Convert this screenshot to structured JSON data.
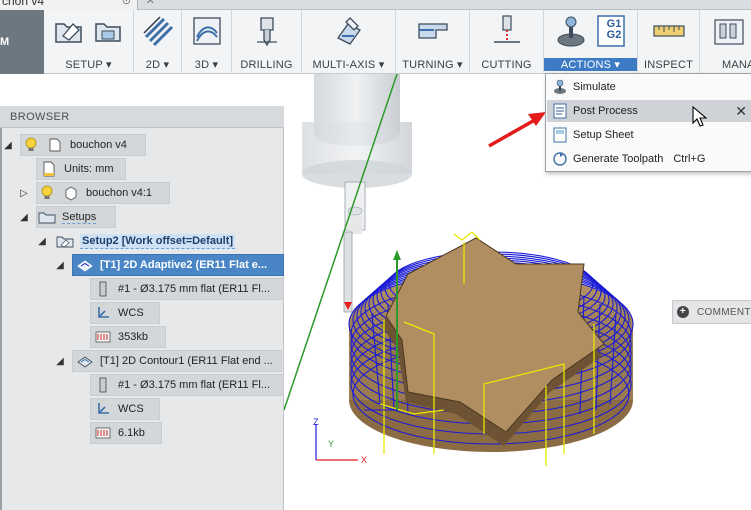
{
  "document": {
    "tab_title": "chon v4"
  },
  "workspace": {
    "label": "M"
  },
  "toolbar": {
    "groups": [
      {
        "label": "SETUP ▾"
      },
      {
        "label": "2D ▾"
      },
      {
        "label": "3D ▾"
      },
      {
        "label": "DRILLING"
      },
      {
        "label": "MULTI-AXIS ▾"
      },
      {
        "label": "TURNING ▾"
      },
      {
        "label": "CUTTING"
      },
      {
        "label": "ACTIONS ▾"
      },
      {
        "label": "INSPECT"
      },
      {
        "label": "MANA"
      }
    ],
    "actions_icon_text": {
      "line1": "G1",
      "line2": "G2"
    }
  },
  "actions_menu": {
    "items": [
      {
        "label": "Simulate",
        "shortcut": ""
      },
      {
        "label": "Post Process",
        "shortcut": ""
      },
      {
        "label": "Setup Sheet",
        "shortcut": ""
      },
      {
        "label": "Generate Toolpath",
        "shortcut": "Ctrl+G"
      }
    ],
    "close_glyph": "✕"
  },
  "browser": {
    "header": "BROWSER",
    "tree": [
      {
        "label": "bouchon v4"
      },
      {
        "label": "Units: mm"
      },
      {
        "label": "bouchon v4:1"
      },
      {
        "label": "Setups"
      },
      {
        "label": "Setup2 [Work offset=Default]"
      },
      {
        "label": "[T1] 2D Adaptive2 (ER11 Flat e..."
      },
      {
        "label": "#1 - Ø3.175 mm flat (ER11 Fl..."
      },
      {
        "label": "WCS"
      },
      {
        "label": "353kb"
      },
      {
        "label": "[T1] 2D Contour1 (ER11 Flat end ..."
      },
      {
        "label": "#1 - Ø3.175 mm flat (ER11 Fl..."
      },
      {
        "label": "WCS"
      },
      {
        "label": "6.1kb"
      }
    ]
  },
  "comments": {
    "label": "COMMENTS"
  },
  "viewport": {
    "axes": {
      "x": "X",
      "y": "Y",
      "z": "Z"
    },
    "colors": {
      "stock": "#a8875f",
      "toolpath": "#1a1ad6",
      "rapid": "#e8e800",
      "pointer_arrow": "#e31b1b"
    }
  }
}
